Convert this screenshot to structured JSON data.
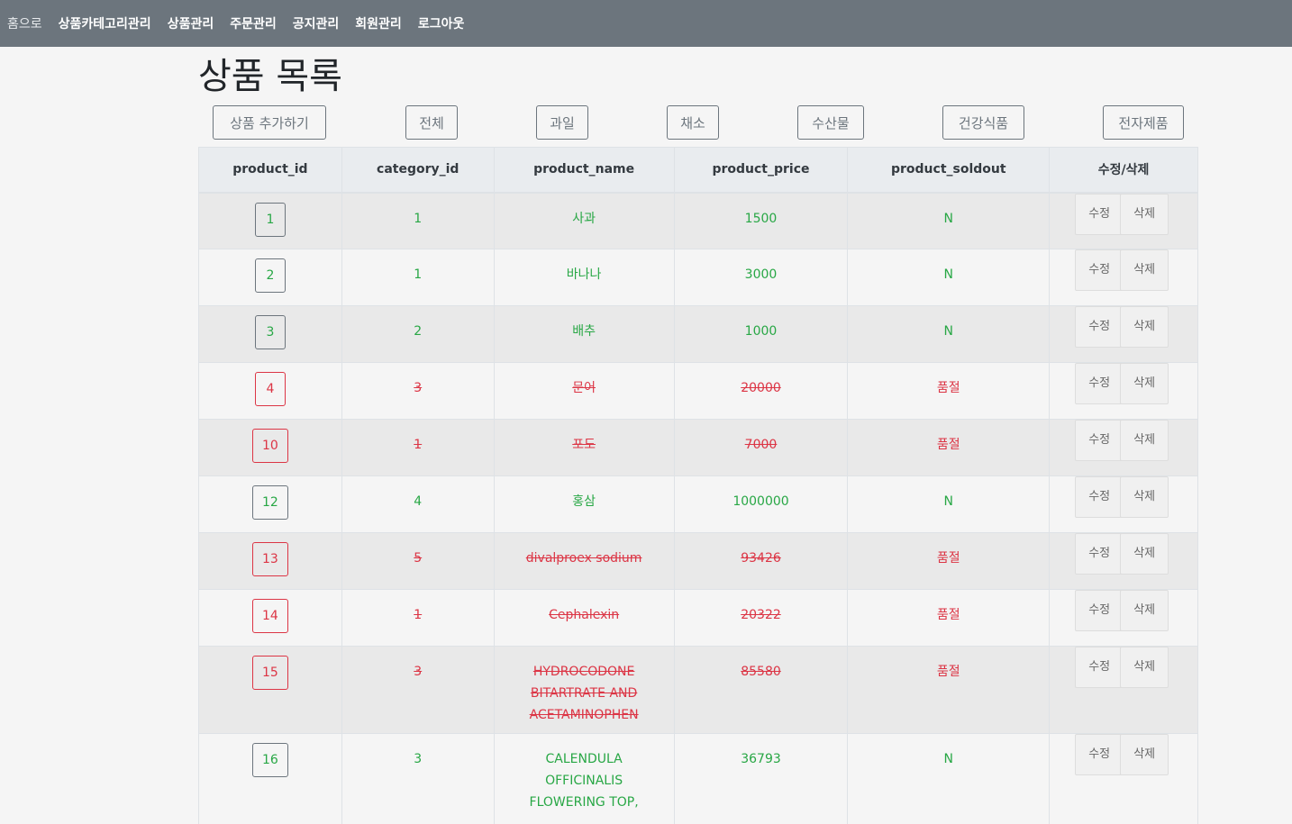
{
  "nav": {
    "home": "홈으로",
    "items": [
      "상품카테고리관리",
      "상품관리",
      "주문관리",
      "공지관리",
      "회원관리",
      "로그아웃"
    ]
  },
  "page_title": "상품 목록",
  "buttons": {
    "add": "상품 추가하기",
    "all": "전체",
    "fruit": "과일",
    "vegetable": "채소",
    "seafood": "수산물",
    "health": "건강식품",
    "electronics": "전자제품"
  },
  "table": {
    "headers": [
      "product_id",
      "category_id",
      "product_name",
      "product_price",
      "product_soldout",
      "수정/삭제"
    ],
    "edit_label": "수정",
    "delete_label": "삭제",
    "rows": [
      {
        "id": "1",
        "category": "1",
        "name": "사과",
        "price": "1500",
        "soldout": "N",
        "status": "ok"
      },
      {
        "id": "2",
        "category": "1",
        "name": "바나나",
        "price": "3000",
        "soldout": "N",
        "status": "ok"
      },
      {
        "id": "3",
        "category": "2",
        "name": "배추",
        "price": "1000",
        "soldout": "N",
        "status": "ok"
      },
      {
        "id": "4",
        "category": "3",
        "name": "문어",
        "price": "20000",
        "soldout": "품절",
        "status": "soldout"
      },
      {
        "id": "10",
        "category": "1",
        "name": "포도",
        "price": "7000",
        "soldout": "품절",
        "status": "soldout"
      },
      {
        "id": "12",
        "category": "4",
        "name": "홍삼",
        "price": "1000000",
        "soldout": "N",
        "status": "ok"
      },
      {
        "id": "13",
        "category": "5",
        "name": "divalproex sodium",
        "price": "93426",
        "soldout": "품절",
        "status": "soldout"
      },
      {
        "id": "14",
        "category": "1",
        "name": "Cephalexin",
        "price": "20322",
        "soldout": "품절",
        "status": "soldout"
      },
      {
        "id": "15",
        "category": "3",
        "name": "HYDROCODONE BITARTRATE AND ACETAMINOPHEN",
        "price": "85580",
        "soldout": "품절",
        "status": "soldout"
      },
      {
        "id": "16",
        "category": "3",
        "name": "CALENDULA OFFICINALIS FLOWERING TOP,",
        "price": "36793",
        "soldout": "N",
        "status": "ok"
      }
    ]
  },
  "colors": {
    "ok": "#28a745",
    "soldout": "#dc3545",
    "navbar": "#6c757d"
  }
}
